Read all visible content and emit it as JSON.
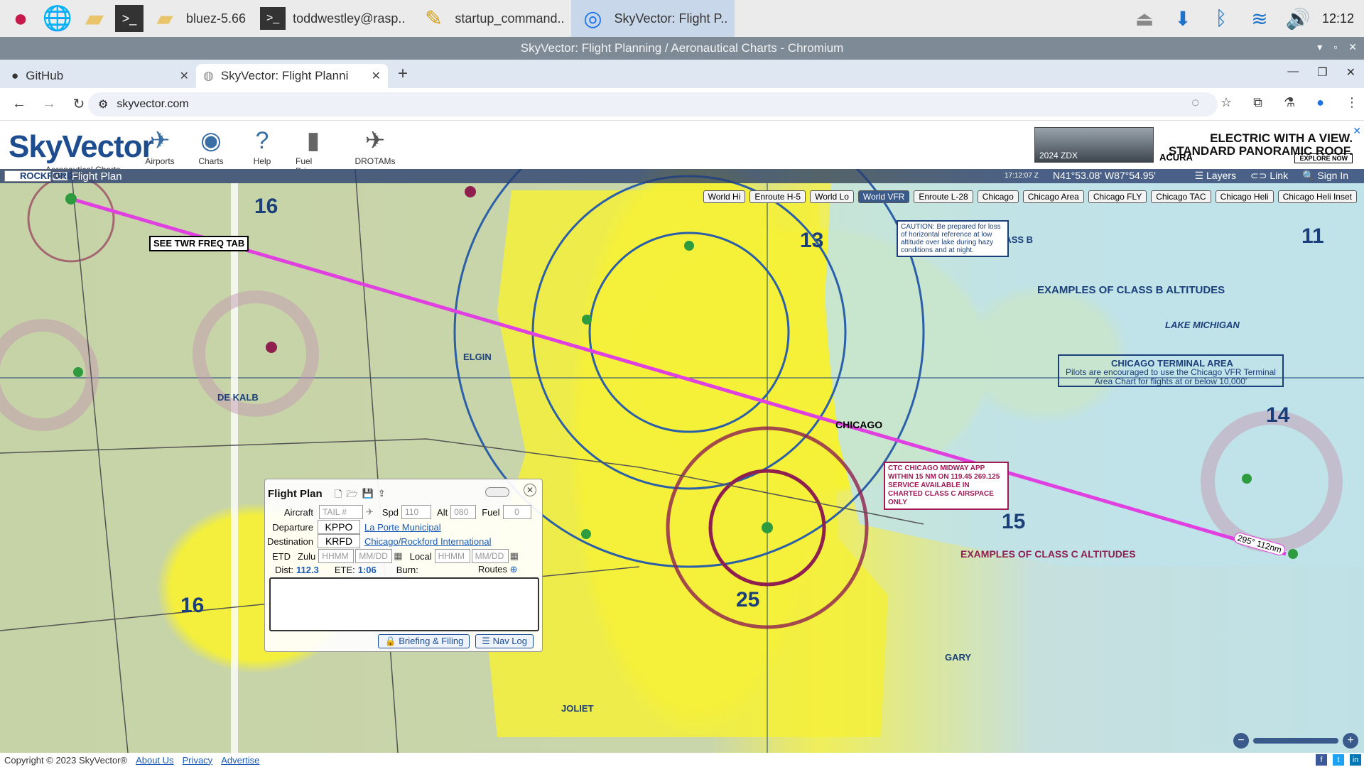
{
  "taskbar": {
    "tasks": [
      {
        "label": "bluez-5.66"
      },
      {
        "label": "toddwestley@rasp.."
      },
      {
        "label": "startup_command.."
      },
      {
        "label": "SkyVector: Flight P.."
      }
    ],
    "clock": "12:12"
  },
  "window": {
    "title": "SkyVector: Flight Planning / Aeronautical Charts - Chromium"
  },
  "browser": {
    "tabs": [
      {
        "title": "GitHub"
      },
      {
        "title": "SkyVector: Flight Planni"
      }
    ],
    "url": "skyvector.com"
  },
  "site": {
    "logo": "SkyVector",
    "tagline": "Aeronautical Charts",
    "menu": [
      "Airports",
      "Charts",
      "Help",
      "Fuel Prices",
      "DROTAMs"
    ],
    "ad": {
      "headline_1": "ELECTRIC WITH A VIEW.",
      "headline_2": "STANDARD PANORAMIC ROOF.",
      "car_label": "2024 ZDX",
      "brand": "ACURA",
      "cta": "EXPLORE NOW"
    }
  },
  "map": {
    "go": "Go",
    "flight_plan_link": "Flight Plan",
    "zulu": "17:12:07 Z",
    "coords": "N41°53.08' W87°54.95'",
    "links": [
      "Layers",
      "Link",
      "Sign In"
    ],
    "chart_tabs": [
      "World Hi",
      "Enroute H-5",
      "World Lo",
      "World VFR",
      "Enroute L-28",
      "Chicago",
      "Chicago Area",
      "Chicago FLY",
      "Chicago TAC",
      "Chicago Heli",
      "Chicago Heli Inset"
    ],
    "active_chart": "World VFR",
    "labels": {
      "chicago": "CHICAGO",
      "class_b": "CHICAGO CLASS B",
      "class_b_alt": "EXAMPLES OF CLASS B ALTITUDES",
      "class_c_alt": "EXAMPLES OF CLASS C ALTITUDES",
      "lake": "LAKE MICHIGAN",
      "terminal": "CHICAGO TERMINAL AREA",
      "terminal_note": "Pilots are encouraged to use the Chicago VFR Terminal Area Chart for flights at or below 10,000'",
      "caution": "CAUTION: Be prepared for loss of horizontal reference at low altitude over lake during hazy conditions and at night.",
      "midway": "CTC CHICAGO MIDWAY APP WITHIN 15 NM ON 119.45 269.125 SERVICE AVAILABLE IN CHARTED CLASS C AIRSPACE ONLY",
      "twr": "SEE TWR FREQ TAB",
      "route_label": "295° 112nm",
      "rockford": "ROCKFORD",
      "elgin": "ELGIN",
      "dekalb": "DE KALB",
      "joliet": "JOLIET",
      "gary": "GARY"
    },
    "numbers": [
      "16",
      "13",
      "11",
      "25",
      "15",
      "14",
      "16"
    ]
  },
  "flight_plan": {
    "title": "Flight Plan",
    "aircraft_label": "Aircraft",
    "aircraft_placeholder": "TAIL #",
    "spd_label": "Spd",
    "spd": "110",
    "alt_label": "Alt",
    "alt": "080",
    "fuel_label": "Fuel",
    "fuel": "0",
    "departure_label": "Departure",
    "departure": "KPPO",
    "departure_name": "La Porte Municipal",
    "destination_label": "Destination",
    "destination": "KRFD",
    "destination_name": "Chicago/Rockford International",
    "etd_label": "ETD",
    "zulu_label": "Zulu",
    "hhmm": "HHMM",
    "mmdd": "MM/DD",
    "local_label": "Local",
    "dist_label": "Dist:",
    "dist": "112.3",
    "ete_label": "ETE:",
    "ete": "1:06",
    "burn_label": "Burn:",
    "routes_label": "Routes",
    "briefing": "Briefing & Filing",
    "navlog": "Nav Log"
  },
  "footer": {
    "copyright": "Copyright © 2023 SkyVector®",
    "links": [
      "About Us",
      "Privacy",
      "Advertise"
    ]
  }
}
